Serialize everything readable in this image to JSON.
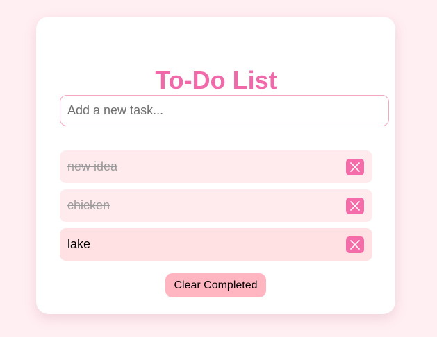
{
  "app": {
    "title": "To-Do List"
  },
  "input": {
    "placeholder": "Add a new task...",
    "value": ""
  },
  "tasks": [
    {
      "text": "new idea",
      "completed": true
    },
    {
      "text": "chicken",
      "completed": true
    },
    {
      "text": "lake",
      "completed": false
    }
  ],
  "delete_icon": "close-icon",
  "clear_button": {
    "label": "Clear Completed"
  },
  "colors": {
    "background": "#ffeef2",
    "title": "#f06aaa",
    "delete_button": "#f46ca8",
    "clear_button": "#ffb6c1",
    "completed_item": "#ffebee",
    "active_item": "#ffe1e3"
  }
}
